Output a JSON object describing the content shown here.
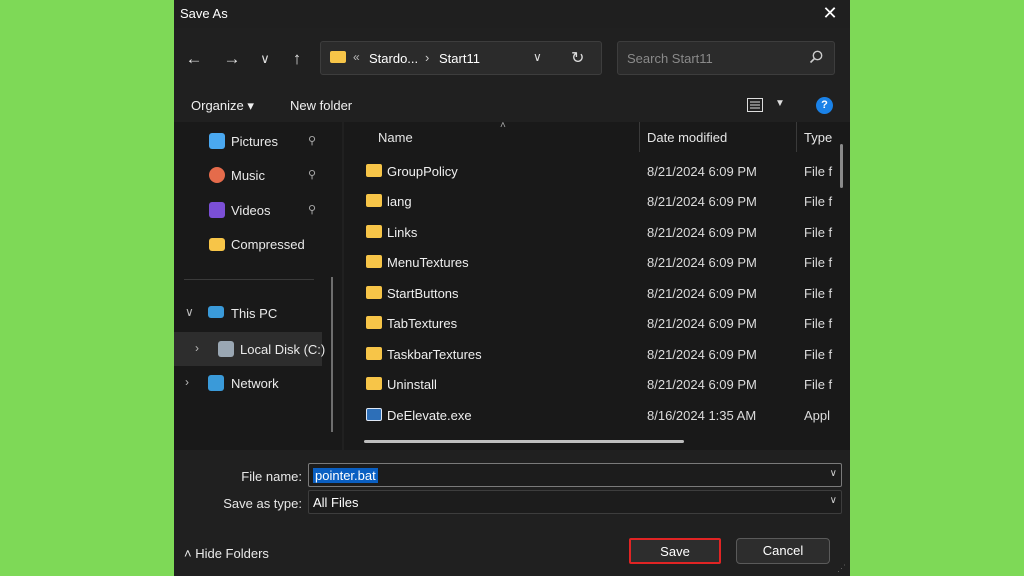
{
  "window": {
    "title": "Save As",
    "close_icon": "close-icon"
  },
  "nav": {
    "back_icon": "←",
    "forward_icon": "→",
    "recent_icon": "∨",
    "up_icon": "↑",
    "address": {
      "chevron": "«",
      "crumbs": [
        "Stardo...",
        "Start11"
      ],
      "separator": "›",
      "dropdown": "∨",
      "refresh": "↻"
    },
    "search": {
      "placeholder": "Search Start11"
    }
  },
  "toolbar": {
    "organize": "Organize ▾",
    "new_folder": "New folder",
    "view_dd": "▼",
    "help": "?"
  },
  "sidebar": {
    "items": [
      {
        "label": "Pictures",
        "icon": "pictures-icon",
        "color": "#4aa8f0",
        "pinned": true
      },
      {
        "label": "Music",
        "icon": "music-icon",
        "color": "#e56b4b",
        "pinned": true
      },
      {
        "label": "Videos",
        "icon": "videos-icon",
        "color": "#7b4fd6",
        "pinned": true
      },
      {
        "label": "Compressed",
        "icon": "folder-icon",
        "color": "#f7c548",
        "pinned": false
      },
      {
        "label": "This PC",
        "icon": "monitor-icon",
        "color": "#3a9ad9",
        "expand": "∨"
      },
      {
        "label": "Local Disk (C:)",
        "icon": "disk-icon",
        "color": "#9aa7b3",
        "expand": "›"
      },
      {
        "label": "Network",
        "icon": "network-icon",
        "color": "#3a9ad9",
        "expand": "›"
      }
    ],
    "pin_glyph": "📌"
  },
  "filelist": {
    "columns": [
      "Name",
      "Date modified",
      "Type"
    ],
    "sort_indicator": "˄",
    "rows": [
      {
        "name": "GroupPolicy",
        "date": "8/21/2024 6:09 PM",
        "type": "File f",
        "kind": "folder"
      },
      {
        "name": "lang",
        "date": "8/21/2024 6:09 PM",
        "type": "File f",
        "kind": "folder"
      },
      {
        "name": "Links",
        "date": "8/21/2024 6:09 PM",
        "type": "File f",
        "kind": "folder"
      },
      {
        "name": "MenuTextures",
        "date": "8/21/2024 6:09 PM",
        "type": "File f",
        "kind": "folder"
      },
      {
        "name": "StartButtons",
        "date": "8/21/2024 6:09 PM",
        "type": "File f",
        "kind": "folder"
      },
      {
        "name": "TabTextures",
        "date": "8/21/2024 6:09 PM",
        "type": "File f",
        "kind": "folder"
      },
      {
        "name": "TaskbarTextures",
        "date": "8/21/2024 6:09 PM",
        "type": "File f",
        "kind": "folder"
      },
      {
        "name": "Uninstall",
        "date": "8/21/2024 6:09 PM",
        "type": "File f",
        "kind": "folder"
      },
      {
        "name": "DeElevate.exe",
        "date": "8/16/2024 1:35 AM",
        "type": "Appl",
        "kind": "exe"
      }
    ]
  },
  "form": {
    "file_name_label": "File name:",
    "file_name_value": "pointer.bat",
    "save_type_label": "Save as type:",
    "save_type_value": "All Files",
    "dropdown_glyph": "∨"
  },
  "footer": {
    "hide_folders": "˄ Hide Folders",
    "save": "Save",
    "cancel": "Cancel",
    "grip": "⋰"
  },
  "colors": {
    "background": "#7ed957",
    "save_highlight": "#e02424",
    "accent": "#1a82e8"
  }
}
